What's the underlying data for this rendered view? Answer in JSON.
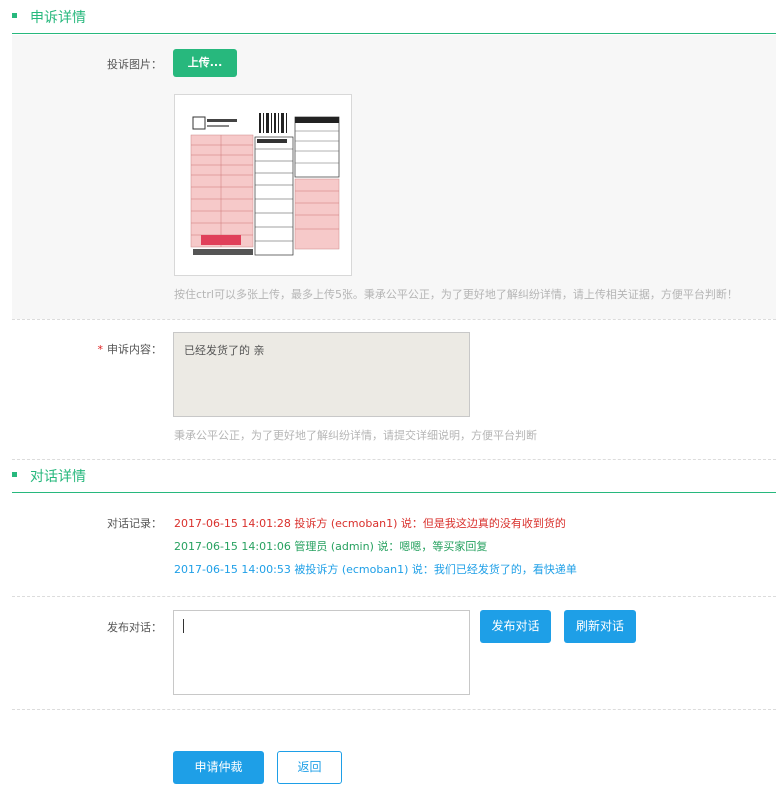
{
  "appeal": {
    "section_title": "申诉详情",
    "upload_label": "投诉图片：",
    "upload_button": "上传...",
    "upload_hint": "按住ctrl可以多张上传，最多上传5张。秉承公平公正，为了更好地了解纠纷详情，请上传相关证据，方便平台判断！",
    "content_required": "*",
    "content_label": "申诉内容：",
    "content_value": "已经发货了的 亲",
    "content_hint": "秉承公平公正，为了更好地了解纠纷详情，请提交详细说明，方便平台判断"
  },
  "dialog": {
    "section_title": "对话详情",
    "records_label": "对话记录：",
    "messages": [
      {
        "text": "2017-06-15 14:01:28 投诉方 (ecmoban1) 说：但是我这边真的没有收到货的",
        "color": "#d9302c"
      },
      {
        "text": "2017-06-15 14:01:06 管理员 (admin) 说：嗯嗯，等买家回复",
        "color": "#27a160"
      },
      {
        "text": "2017-06-15 14:00:53 被投诉方 (ecmoban1) 说：我们已经发货了的，看快递单",
        "color": "#1e9fe7"
      }
    ],
    "post_label": "发布对话：",
    "post_value": "",
    "post_button": "发布对话",
    "refresh_button": "刷新对话"
  },
  "footer": {
    "arbitration_button": "申请仲裁",
    "back_button": "返回"
  },
  "colors": {
    "accent": "#27b87d",
    "primary": "#1e9fe7"
  }
}
